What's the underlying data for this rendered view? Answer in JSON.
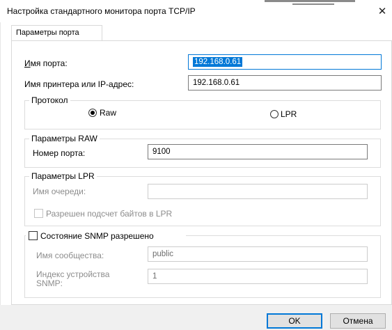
{
  "window": {
    "title": "Настройка стандартного монитора порта TCP/IP",
    "close_icon": "close-icon"
  },
  "tabs": [
    {
      "label": "Параметры порта",
      "active": true
    }
  ],
  "port": {
    "name_label": "Имя порта:",
    "name_value": "192.168.0.61",
    "printer_label": "Имя принтера или IP-адрес:",
    "printer_value": "192.168.0.61"
  },
  "protocol": {
    "group_title": "Протокол",
    "raw_label": "Raw",
    "lpr_label": "LPR",
    "selected": "Raw"
  },
  "raw_settings": {
    "group_title": "Параметры RAW",
    "port_number_label": "Номер порта:",
    "port_number_value": "9100"
  },
  "lpr_settings": {
    "group_title": "Параметры LPR",
    "queue_label": "Имя очереди:",
    "queue_value": "",
    "byte_count_label": "Разрешен подсчет байтов в LPR",
    "byte_count_checked": false
  },
  "snmp": {
    "checkbox_label": "Состояние SNMP разрешено",
    "checked": false,
    "community_label": "Имя сообщества:",
    "community_value": "public",
    "device_index_label": "Индекс устройства SNMP:",
    "device_index_value": "1"
  },
  "buttons": {
    "ok": "OK",
    "cancel": "Отмена"
  },
  "colors": {
    "accent": "#0078d7",
    "disabled_text": "#8c8c8c",
    "footer_bg": "#f0f0f0"
  }
}
